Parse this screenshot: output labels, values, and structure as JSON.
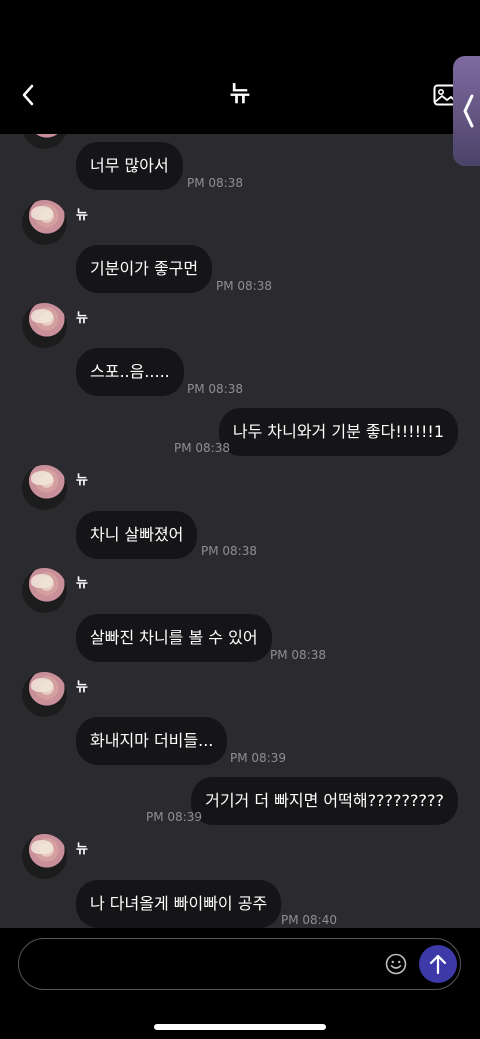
{
  "header": {
    "title": "뉴",
    "back_icon": "chevron-left-icon",
    "gallery_icon": "image-icon",
    "side_handle_icon": "chevron-left-icon"
  },
  "messages": [
    {
      "type": "received",
      "text": "너무 많아서",
      "time": "PM 08:38",
      "show_avatar": false
    },
    {
      "type": "received",
      "sender": "뉴",
      "text": "기분이가 좋구먼",
      "time": "PM 08:38",
      "show_avatar": true
    },
    {
      "type": "received",
      "sender": "뉴",
      "text": "스포..음.....",
      "time": "PM 08:38",
      "show_avatar": true
    },
    {
      "type": "sent",
      "text": "나두 차니와거 기분 좋다!!!!!!1",
      "time": "PM 08:38"
    },
    {
      "type": "received",
      "sender": "뉴",
      "text": "차니 살빠졌어",
      "time": "PM 08:38",
      "show_avatar": true
    },
    {
      "type": "received",
      "sender": "뉴",
      "text": "살빠진 차니를 볼 수 있어",
      "time": "PM 08:38",
      "show_avatar": true
    },
    {
      "type": "received",
      "sender": "뉴",
      "text": "화내지마 더비들...",
      "time": "PM 08:39",
      "show_avatar": true
    },
    {
      "type": "sent",
      "text": "거기거 더 빠지면 어떡해?????????",
      "time": "PM 08:39"
    },
    {
      "type": "received",
      "sender": "뉴",
      "text": "나 다녀올게 빠이빠이 공주",
      "time": "PM 08:40",
      "show_avatar": true
    }
  ],
  "composer": {
    "placeholder": "",
    "emoji_icon": "smiley-icon",
    "send_icon": "arrow-up-icon",
    "send_color": "#3d3aa8"
  }
}
